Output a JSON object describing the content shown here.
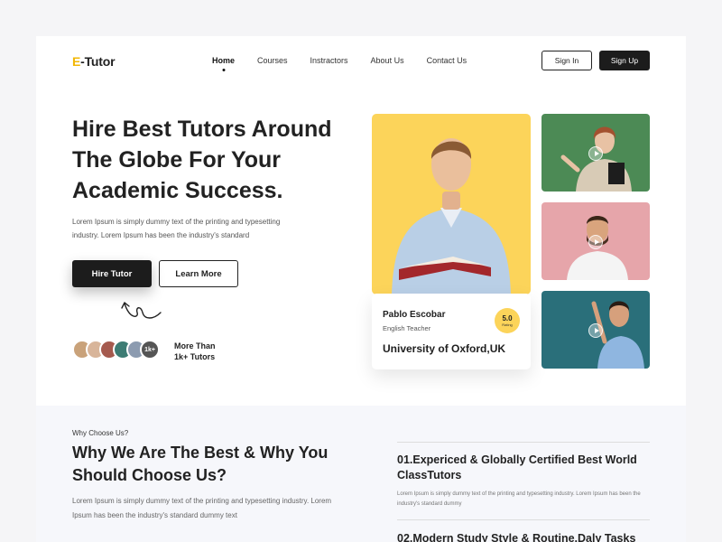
{
  "logo": {
    "e": "E",
    "rest": "-Tutor"
  },
  "nav": {
    "items": [
      "Home",
      "Courses",
      "Instractors",
      "About Us",
      "Contact Us"
    ]
  },
  "auth": {
    "sign_in": "Sign In",
    "sign_up": "Sign Up"
  },
  "hero": {
    "title": "Hire Best Tutors Around The Globe For Your Academic Success.",
    "desc": "Lorem Ipsum is simply dummy text of the printing and typesetting industry. Lorem Ipsum has been the industry's standard",
    "hire": "Hire Tutor",
    "learn": "Learn More",
    "avatar_more": "1k+",
    "tutors_line1": "More Than",
    "tutors_line2": "1k+ Tutors"
  },
  "card": {
    "name": "Pablo Escobar",
    "role": "English Teacher",
    "rating": "5.0",
    "rating_label": "Rating",
    "university": "University of Oxford,UK"
  },
  "why": {
    "kicker": "Why Choose Us?",
    "title": "Why We Are The Best & Why You Should Choose Us?",
    "desc": "Lorem Ipsum is simply dummy text of the printing and typesetting industry. Lorem Ipsum has been the industry's standard dummy text",
    "features": [
      {
        "title": "01.Expericed & Globally Certified Best World ClassTutors",
        "desc": "Lorem Ipsum is simply dummy text of the printing and typesetting industry. Lorem Ipsum has been the industry's standard dummy"
      },
      {
        "title": "02.Modern Study Style & Routine,Daly Tasks",
        "desc": ""
      }
    ]
  },
  "colors": {
    "accent": "#fcd45a",
    "dark": "#1c1c1c",
    "section_bg": "#f6f7fb"
  }
}
